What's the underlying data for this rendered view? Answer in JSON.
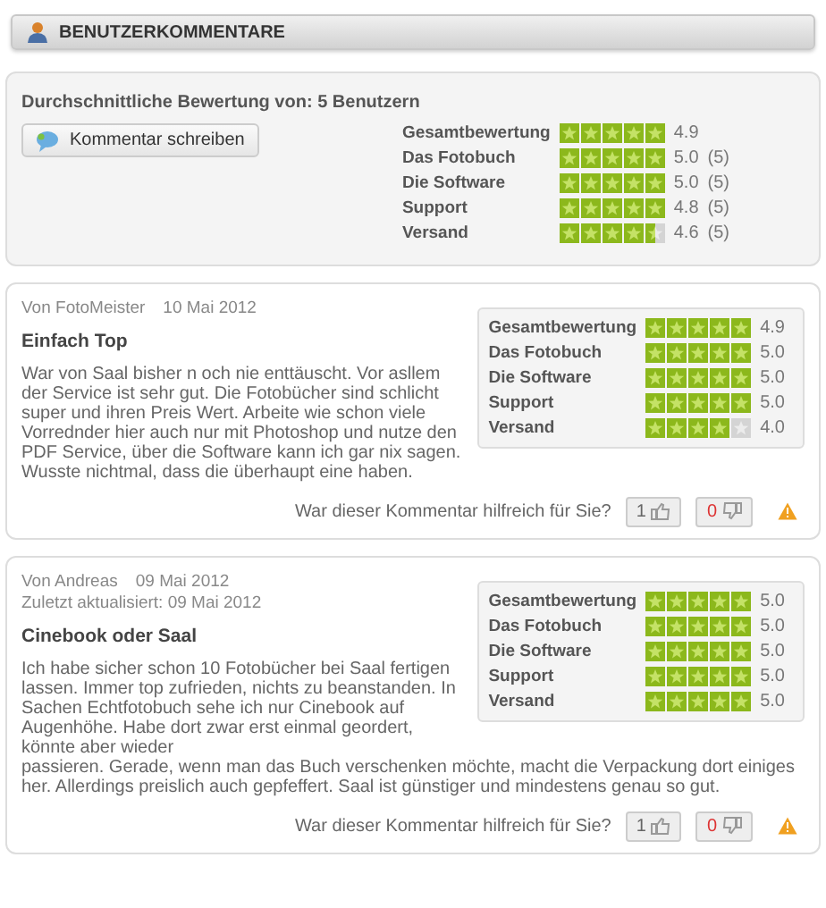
{
  "header": {
    "title": "BENUTZERKOMMENTARE"
  },
  "summary": {
    "title": "Durchschnittliche Bewertung von: 5 Benutzern",
    "button": "Kommentar schreiben",
    "ratings": [
      {
        "label": "Gesamtbewertung",
        "stars": 5,
        "score": "4.9"
      },
      {
        "label": "Das Fotobuch",
        "stars": 5,
        "score": "5.0",
        "count": "(5)"
      },
      {
        "label": "Die Software",
        "stars": 5,
        "score": "5.0",
        "count": "(5)"
      },
      {
        "label": "Support",
        "stars": 5,
        "score": "4.8",
        "count": "(5)"
      },
      {
        "label": "Versand",
        "stars": 4.5,
        "score": "4.6",
        "count": "(5)"
      }
    ]
  },
  "comments": [
    {
      "author": "Von FotoMeister",
      "date": "10 Mai 2012",
      "title": "Einfach Top",
      "body": [
        "War von Saal bisher n och nie enttäuscht. Vor asllem der Service ist sehr gut. Die Fotobücher sind schlicht super und ihren Preis Wert. Arbeite wie schon viele Vorrednder hier auch nur mit Photoshop und nutze den PDF Service, über die Software kann ich gar nix sagen. Wusste nichtmal, dass die überhaupt eine haben."
      ],
      "ratings": [
        {
          "label": "Gesamtbewertung",
          "stars": 5,
          "score": "4.9"
        },
        {
          "label": "Das Fotobuch",
          "stars": 5,
          "score": "5.0"
        },
        {
          "label": "Die Software",
          "stars": 5,
          "score": "5.0"
        },
        {
          "label": "Support",
          "stars": 5,
          "score": "5.0"
        },
        {
          "label": "Versand",
          "stars": 4,
          "score": "4.0"
        }
      ],
      "question": "War dieser Kommentar hilfreich für Sie?",
      "yes": "1",
      "no": "0"
    },
    {
      "author": "Von Andreas",
      "date": "09 Mai 2012",
      "updated": "Zuletzt aktualisiert: 09 Mai 2012",
      "title": "Cinebook oder Saal",
      "body": [
        "Ich habe sicher schon 10 Fotobücher bei Saal fertigen lassen. Immer top zufrieden, nichts zu beanstanden. In Sachen Echtfotobuch sehe ich nur Cinebook auf Augenhöhe. Habe dort zwar erst einmal geordert, könnte aber wieder",
        "passieren. Gerade, wenn man das Buch verschenken möchte, macht die Verpackung dort einiges her. Allerdings preislich auch gepfeffert. Saal ist günstiger und mindestens genau so gut."
      ],
      "ratings": [
        {
          "label": "Gesamtbewertung",
          "stars": 5,
          "score": "5.0"
        },
        {
          "label": "Das Fotobuch",
          "stars": 5,
          "score": "5.0"
        },
        {
          "label": "Die Software",
          "stars": 5,
          "score": "5.0"
        },
        {
          "label": "Support",
          "stars": 5,
          "score": "5.0"
        },
        {
          "label": "Versand",
          "stars": 5,
          "score": "5.0"
        }
      ],
      "question": "War dieser Kommentar hilfreich für Sie?",
      "yes": "1",
      "no": "0"
    }
  ]
}
